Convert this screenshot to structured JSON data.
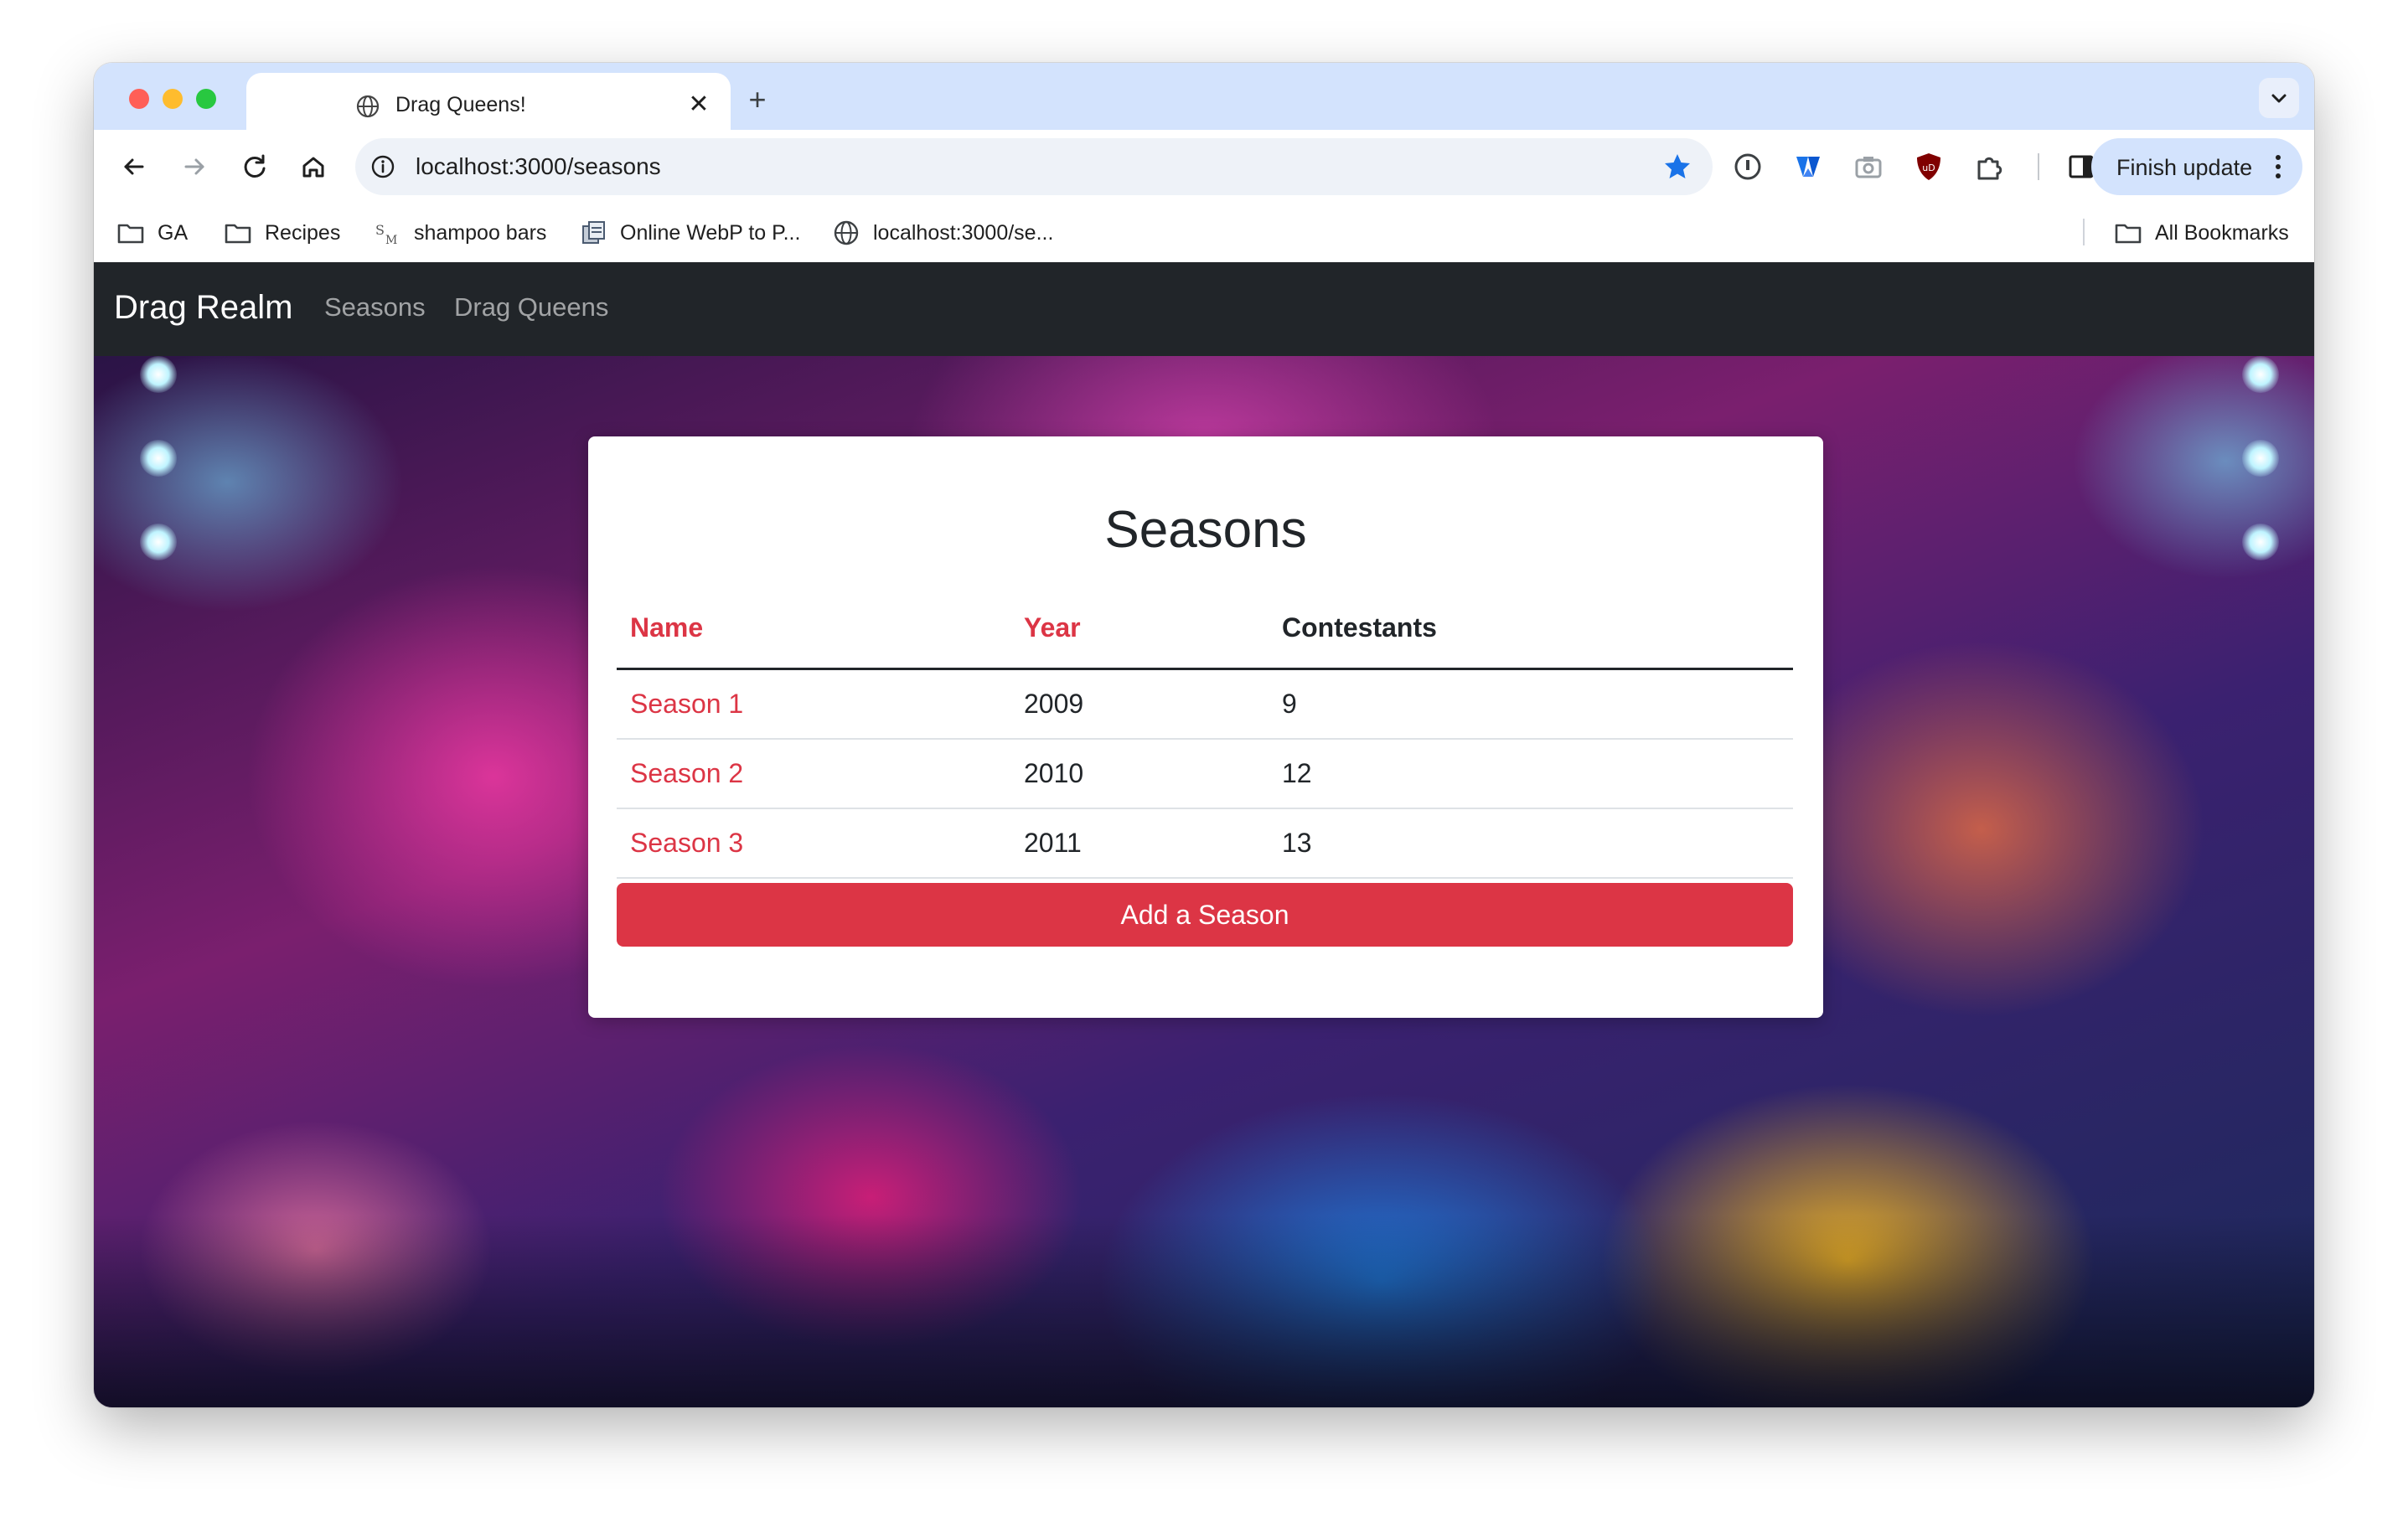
{
  "browser": {
    "tab": {
      "title": "Drag Queens!",
      "close": "✕"
    },
    "new_tab": "+",
    "address": {
      "url": "localhost:3000/seasons"
    },
    "finish_update_label": "Finish update",
    "bookmarks": [
      {
        "label": "GA",
        "icon": "folder-icon"
      },
      {
        "label": "Recipes",
        "icon": "folder-icon"
      },
      {
        "label": "shampoo bars",
        "icon": "sm-favicon"
      },
      {
        "label": "Online WebP to P...",
        "icon": "converter-favicon"
      },
      {
        "label": "localhost:3000/se...",
        "icon": "globe-icon"
      }
    ],
    "all_bookmarks_label": "All Bookmarks"
  },
  "navbar": {
    "brand": "Drag Realm",
    "links": [
      "Seasons",
      "Drag Queens"
    ]
  },
  "card": {
    "title": "Seasons",
    "headers": [
      "Name",
      "Year",
      "Contestants"
    ],
    "rows": [
      {
        "name": "Season 1",
        "year": "2009",
        "contestants": "9"
      },
      {
        "name": "Season 2",
        "year": "2010",
        "contestants": "12"
      },
      {
        "name": "Season 3",
        "year": "2011",
        "contestants": "13"
      }
    ],
    "add_button": "Add a Season"
  },
  "colors": {
    "accent_red": "#dc3545",
    "navbar_bg": "#212529",
    "tabstrip_bg": "#d3e3fd"
  }
}
